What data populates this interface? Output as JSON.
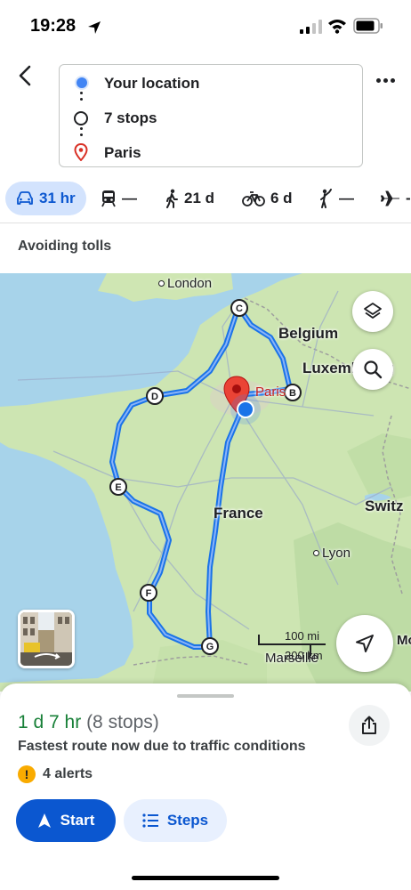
{
  "status_bar": {
    "time": "19:28"
  },
  "header": {
    "origin": "Your location",
    "stops": "7 stops",
    "destination": "Paris"
  },
  "modes": [
    {
      "icon": "car-icon",
      "label": "31 hr",
      "selected": true
    },
    {
      "icon": "train-icon",
      "label": "—"
    },
    {
      "icon": "walk-icon",
      "label": "21 d"
    },
    {
      "icon": "bike-icon",
      "label": "6 d"
    },
    {
      "icon": "ride-icon",
      "label": "—"
    },
    {
      "icon": "plane-icon",
      "label": "-"
    }
  ],
  "avoid_text": "Avoiding tolls",
  "map": {
    "labels": {
      "london": "London",
      "belgium": "Belgium",
      "luxembourg": "Luxembourg",
      "paris": "Paris",
      "france": "France",
      "lyon": "Lyon",
      "switzerland": "Switz",
      "marseille": "Marseille",
      "monaco": "Mo"
    },
    "markers": [
      "B",
      "C",
      "D",
      "E",
      "F",
      "G"
    ],
    "scale": {
      "miles": "100 mi",
      "km": "200 km"
    }
  },
  "sheet": {
    "duration": "1 d 7 hr",
    "stops": "(8 stops)",
    "reason": "Fastest route now due to traffic conditions",
    "alerts": "4 alerts",
    "start": "Start",
    "steps": "Steps"
  },
  "colors": {
    "route": "#4285f4",
    "accent": "#0b57d0",
    "green": "#188038"
  }
}
